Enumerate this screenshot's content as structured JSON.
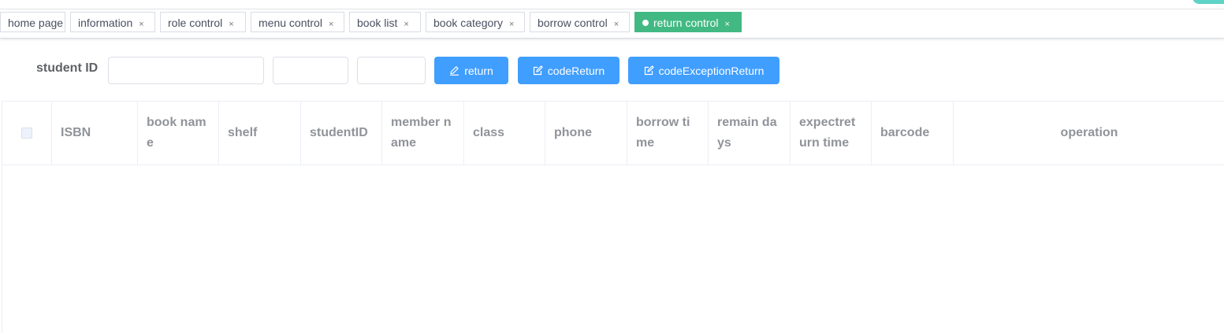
{
  "tabs": [
    {
      "label": "home page",
      "closable": false
    },
    {
      "label": "information",
      "closable": true
    },
    {
      "label": "role control",
      "closable": true
    },
    {
      "label": "menu control",
      "closable": true
    },
    {
      "label": "book list",
      "closable": true
    },
    {
      "label": "book category",
      "closable": true
    },
    {
      "label": "borrow control",
      "closable": true
    },
    {
      "label": "return control",
      "closable": true,
      "active": true
    }
  ],
  "close_glyph": "×",
  "search": {
    "student_id_label": "student ID",
    "student_id_value": "",
    "field2_value": "",
    "field3_value": ""
  },
  "buttons": {
    "return_label": "return",
    "code_return_label": "codeReturn",
    "code_exception_return_label": "codeExceptionReturn"
  },
  "table": {
    "columns": [
      "ISBN",
      "book name",
      "shelf",
      "studentID",
      "member name",
      "class",
      "phone",
      "borrow time",
      "remain days",
      "expectreturn time",
      "barcode",
      "operation"
    ],
    "rows": []
  },
  "colors": {
    "active_tab": "#42b983",
    "primary_button": "#409eff"
  },
  "icons": {
    "return_button": "pencil-icon",
    "code_return_button": "edit-icon",
    "code_exception_return_button": "edit-icon"
  }
}
